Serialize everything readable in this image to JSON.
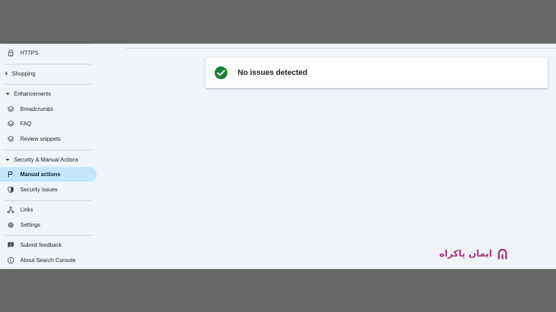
{
  "sidebar": {
    "https": {
      "label": "HTTPS",
      "icon": "lock-icon"
    },
    "shopping": {
      "label": "Shopping"
    },
    "enhancements": {
      "label": "Enhancements",
      "items": [
        {
          "label": "Breadcrumbs",
          "icon": "layers-icon"
        },
        {
          "label": "FAQ",
          "icon": "layers-icon"
        },
        {
          "label": "Review snippets",
          "icon": "layers-icon"
        }
      ]
    },
    "security": {
      "label": "Security & Manual Actions",
      "items": [
        {
          "label": "Manual actions",
          "icon": "flag-icon",
          "active": true
        },
        {
          "label": "Security issues",
          "icon": "shield-icon"
        }
      ]
    },
    "links": {
      "label": "Links",
      "icon": "links-icon"
    },
    "settings": {
      "label": "Settings",
      "icon": "gear-icon"
    },
    "feedback": {
      "label": "Submit feedback",
      "icon": "feedback-icon"
    },
    "about": {
      "label": "About Search Console",
      "icon": "info-icon"
    }
  },
  "main": {
    "status_card": {
      "text": "No issues detected",
      "icon": "check-circle-icon",
      "color": "#188038"
    }
  },
  "watermark": {
    "text": "ایمان پاکراه",
    "color": "#b0307a"
  },
  "colors": {
    "active_bg": "#c2e7ff",
    "app_bg": "#f0f4f9",
    "frame_bg": "#666666"
  }
}
